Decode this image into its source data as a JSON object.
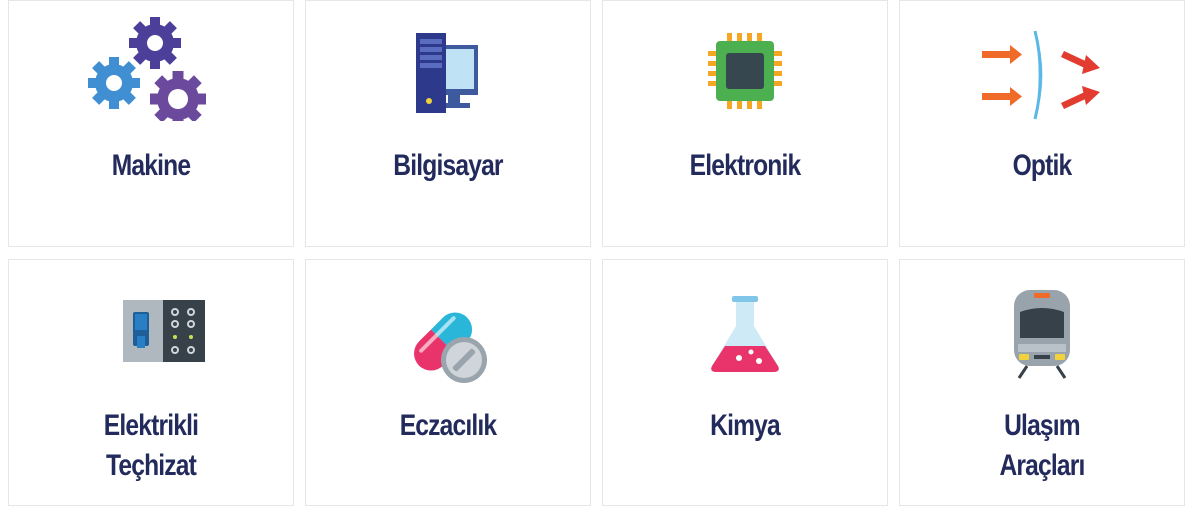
{
  "categories": [
    {
      "label": "Makine",
      "icon": "gears-icon"
    },
    {
      "label": "Bilgisayar",
      "icon": "desktop-computer-icon"
    },
    {
      "label": "Elektronik",
      "icon": "microchip-icon"
    },
    {
      "label": "Optik",
      "icon": "lens-refraction-icon"
    },
    {
      "label_lines": [
        "Elektrikli",
        "Teçhizat"
      ],
      "icon": "electrical-panel-icon"
    },
    {
      "label": "Eczacılık",
      "icon": "pills-icon"
    },
    {
      "label": "Kimya",
      "icon": "flask-icon"
    },
    {
      "label_lines": [
        "Ulaşım",
        "Araçları"
      ],
      "icon": "train-icon"
    }
  ],
  "colors": {
    "label_text": "#232a5c",
    "card_border": "#e6e6e6",
    "gear_blue": "#3f8fd2",
    "gear_purple": "#6b4a9e",
    "gear_indigo": "#4b3f9a",
    "arrow_orange": "#f06a2a",
    "chip_green": "#4caf50",
    "pill_pink": "#e8336b",
    "pill_cyan": "#29b6d9",
    "flask_pink": "#e8336b"
  }
}
